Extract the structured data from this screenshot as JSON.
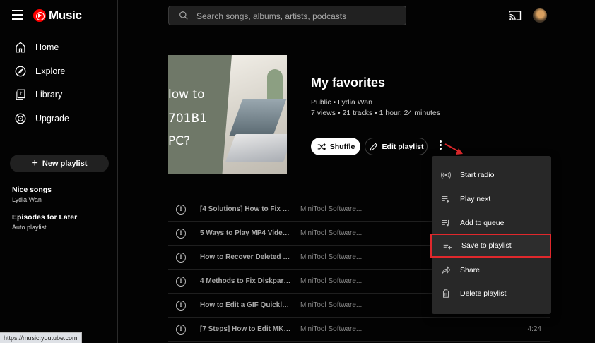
{
  "app": {
    "logo_text": "Music"
  },
  "sidebar": {
    "nav": [
      {
        "label": "Home",
        "icon": "home-icon"
      },
      {
        "label": "Explore",
        "icon": "compass-icon"
      },
      {
        "label": "Library",
        "icon": "library-icon"
      },
      {
        "label": "Upgrade",
        "icon": "upgrade-icon"
      }
    ],
    "new_playlist_label": "New playlist",
    "playlists": [
      {
        "name": "Nice songs",
        "subtitle": "Lydia Wan"
      },
      {
        "name": "Episodes for Later",
        "subtitle": "Auto playlist"
      }
    ]
  },
  "search": {
    "placeholder": "Search songs, albums, artists, podcasts"
  },
  "status_bar": {
    "url": "https://music.youtube.com"
  },
  "playlist": {
    "title": "My favorites",
    "meta_line1": "Public • Lydia Wan",
    "meta_line2": "7 views • 21 tracks • 1 hour, 24 minutes",
    "cover_text": [
      "low to",
      "701B1",
      "PC?"
    ],
    "shuffle_label": "Shuffle",
    "edit_label": "Edit playlist"
  },
  "tracks": [
    {
      "title": "[4 Solutions] How to Fix Erro...",
      "artist": "MiniTool Software...",
      "duration": ""
    },
    {
      "title": "5 Ways to Play MP4 Videos ...",
      "artist": "MiniTool Software...",
      "duration": ""
    },
    {
      "title": "How to Recover Deleted Dro...",
      "artist": "MiniTool Software...",
      "duration": ""
    },
    {
      "title": "4 Methods to Fix Diskpart F...",
      "artist": "MiniTool Software...",
      "duration": ""
    },
    {
      "title": "How to Edit a GIF Quickly an...",
      "artist": "MiniTool Software...",
      "duration": ""
    },
    {
      "title": "[7 Steps] How to Edit MKV F...",
      "artist": "MiniTool Software...",
      "duration": "4:24"
    }
  ],
  "menu": {
    "items": [
      {
        "label": "Start radio",
        "icon": "radio-icon"
      },
      {
        "label": "Play next",
        "icon": "play-next-icon"
      },
      {
        "label": "Add to queue",
        "icon": "add-to-queue-icon"
      },
      {
        "label": "Save to playlist",
        "icon": "save-to-playlist-icon",
        "highlighted": true
      },
      {
        "label": "Share",
        "icon": "share-icon"
      },
      {
        "label": "Delete playlist",
        "icon": "trash-icon"
      }
    ]
  },
  "colors": {
    "accent": "#ff0000",
    "highlight_border": "#e0282c",
    "menu_bg": "#282828",
    "background": "#030303"
  }
}
